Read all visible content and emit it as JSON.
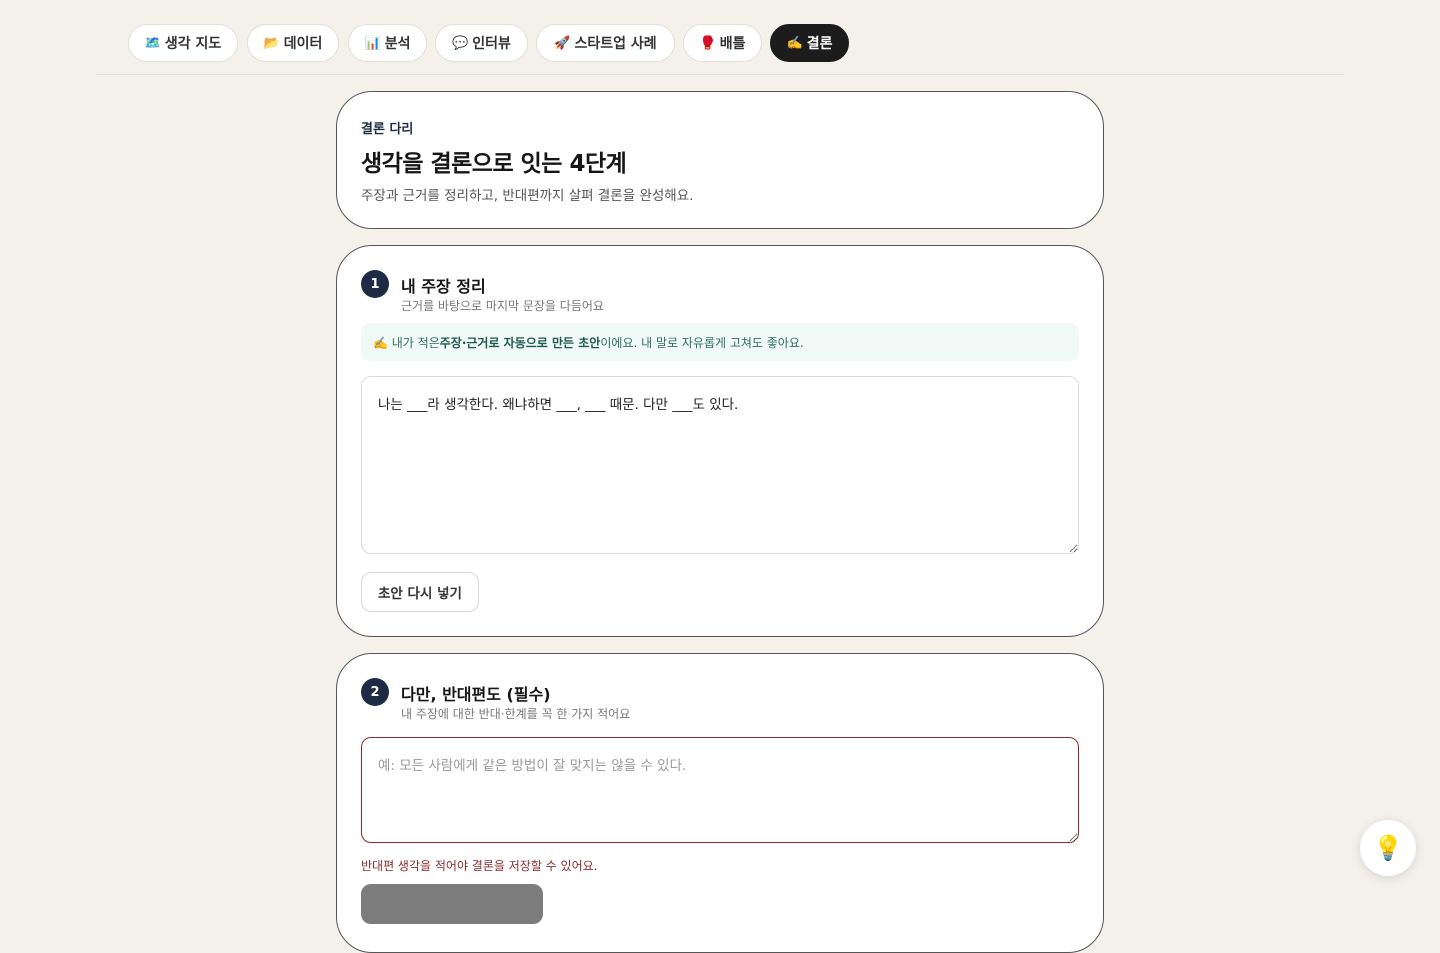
{
  "tabs": [
    {
      "icon": "🗺️",
      "label": "생각 지도"
    },
    {
      "icon": "📂",
      "label": "데이터"
    },
    {
      "icon": "📊",
      "label": "분석"
    },
    {
      "icon": "💬",
      "label": "인터뷰"
    },
    {
      "icon": "🚀",
      "label": "스타트업 사례"
    },
    {
      "icon": "🥊",
      "label": "배틀"
    },
    {
      "icon": "✍️",
      "label": "결론"
    }
  ],
  "active_tab": "결론",
  "hero": {
    "eyebrow": "결론 다리",
    "title": "생각을 결론으로 잇는 4단계",
    "subtitle": "주장과 근거를 정리하고, 반대편까지 살펴 결론을 완성해요."
  },
  "step1": {
    "number": "1",
    "title": "내 주장 정리",
    "subtitle": "근거를 바탕으로 마지막 문장을 다듬어요",
    "note_prefix": "✍️ 내가 적은 ",
    "note_bold": "주장·근거로 자동으로 만든 초안",
    "note_suffix": "이에요. 내 말로 자유롭게 고쳐도 좋아요.",
    "draft_value": "나는 ___라 생각한다. 왜냐하면 ___, ___ 때문. 다만 ___도 있다.",
    "reset_button": "초안 다시 넣기"
  },
  "step2": {
    "number": "2",
    "title": "다만, 반대편도 (필수)",
    "subtitle": "내 주장에 대한 반대·한계를 꼭 한 가지 적어요",
    "placeholder": "예: 모든 사람에게 같은 방법이 잘 맞지는 않을 수 있다.",
    "error": "반대편 생각을 적어야 결론을 저장할 수 있어요."
  },
  "fab_icon": "lightbulb-icon",
  "colors": {
    "background": "#f3f1ea",
    "accent": "#1f2a44",
    "error": "#8a2b2b",
    "note_bg": "#f1f9f6"
  }
}
